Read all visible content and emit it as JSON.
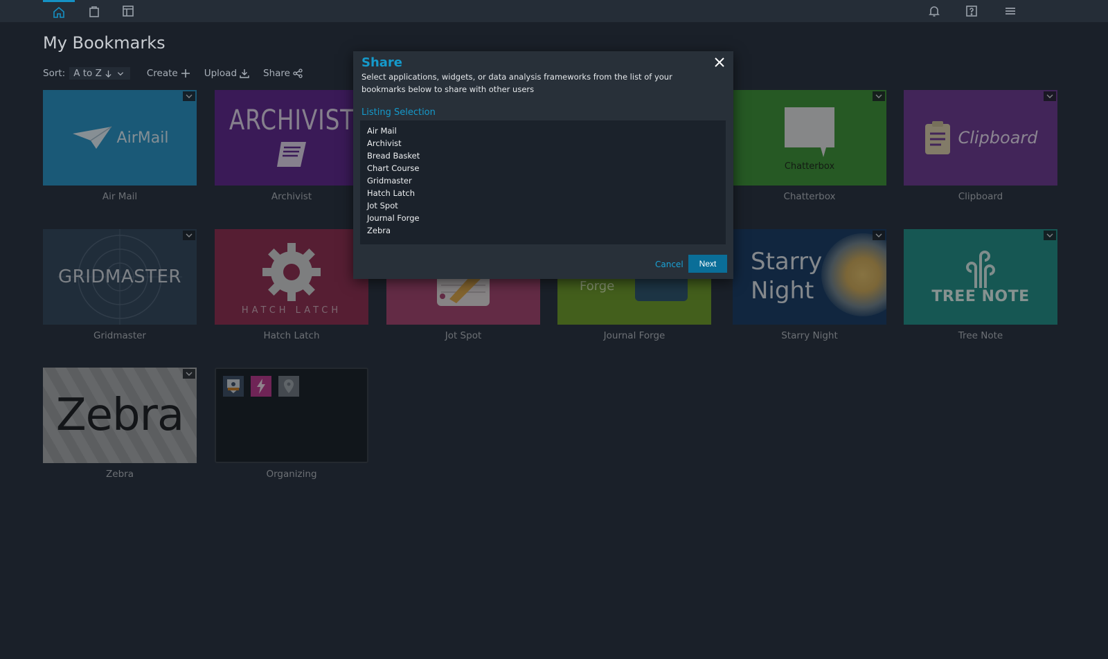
{
  "nav": {
    "left_icons": [
      "home-icon",
      "bag-icon",
      "layout-icon"
    ],
    "right_icons": [
      "bell-icon",
      "help-icon",
      "menu-icon"
    ]
  },
  "page": {
    "title": "My Bookmarks"
  },
  "toolbar": {
    "sort_label": "Sort:",
    "sort_value": "A to Z",
    "create_label": "Create",
    "upload_label": "Upload",
    "share_label": "Share"
  },
  "tiles": [
    {
      "label": "Air Mail",
      "logo_text": "AirMail",
      "color": "#2a8fc0"
    },
    {
      "label": "Archivist",
      "logo_text": "ARCHIVIST",
      "color": "#5e2a8d"
    },
    {
      "label": "Chatterbox",
      "logo_text": "Chatterbox",
      "color": "#3d8f3a"
    },
    {
      "label": "Clipboard",
      "logo_text": "Clipboard",
      "color": "#6a3b8f"
    },
    {
      "label": "Gridmaster",
      "logo_text": "GRIDMASTER",
      "color": "#34495e"
    },
    {
      "label": "Hatch Latch",
      "logo_text": "HATCH LATCH",
      "color": "#8b3052"
    },
    {
      "label": "Jot Spot",
      "logo_text": "",
      "color": "#a0466f"
    },
    {
      "label": "Journal Forge",
      "logo_text": "Forge",
      "color": "#6c9a2d"
    },
    {
      "label": "Starry Night",
      "logo_text_line1": "Starry",
      "logo_text_line2": "Night",
      "color": "#1c3e66"
    },
    {
      "label": "Tree Note",
      "logo_text": "TREE NOTE",
      "color": "#238c86"
    },
    {
      "label": "Zebra",
      "logo_text": "Zebra",
      "color": "#9b9ea1"
    },
    {
      "label": "Organizing",
      "folder_icons": [
        "mapp-icon",
        "lightning-icon",
        "map-pin-icon"
      ]
    }
  ],
  "dialog": {
    "title": "Share",
    "description": "Select applications, widgets, or data analysis frameworks from the list of your bookmarks below to share with other users",
    "section_label": "Listing Selection",
    "items": [
      "Air Mail",
      "Archivist",
      "Bread Basket",
      "Chart Course",
      "Gridmaster",
      "Hatch Latch",
      "Jot Spot",
      "Journal Forge",
      "Zebra"
    ],
    "cancel_label": "Cancel",
    "next_label": "Next"
  }
}
